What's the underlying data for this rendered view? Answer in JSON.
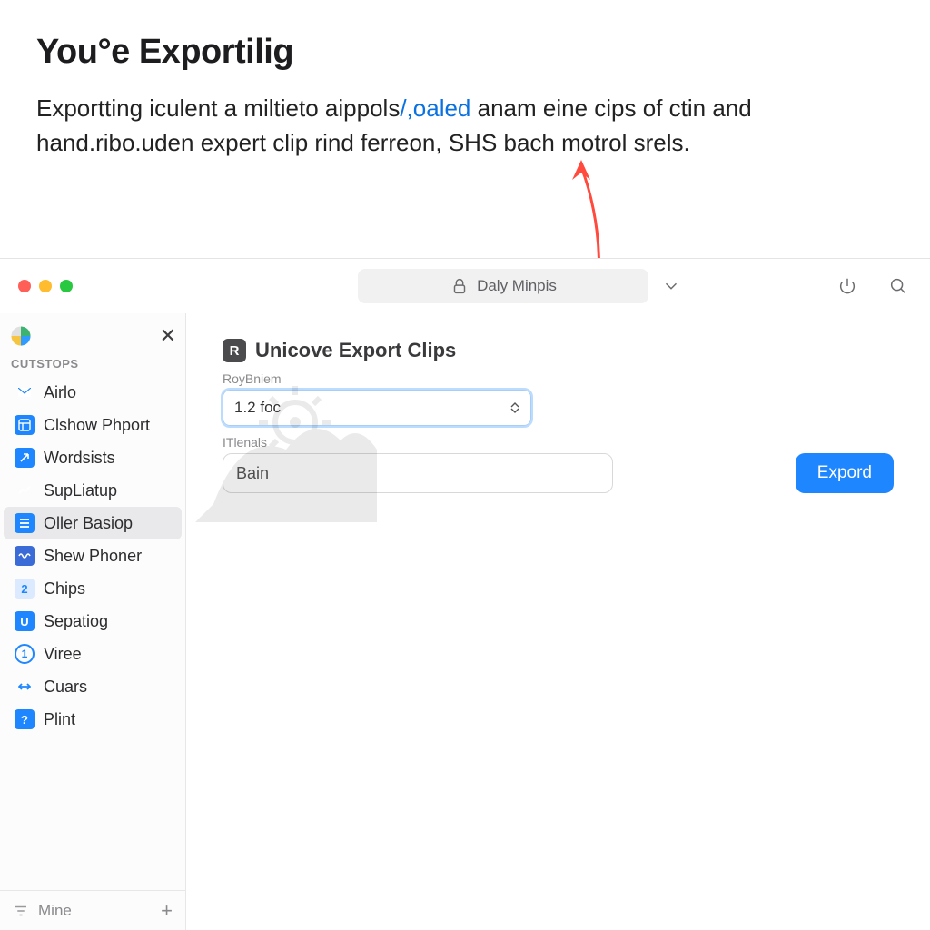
{
  "header": {
    "title": "You°e Exportilig",
    "desc_before": "Exportting iculent a miltieto aippols",
    "desc_link": "/,oaled",
    "desc_after": " anam eine cips of ctin and hand.ribo.uden expert clip rind ferreon, SHS bach motrol srels."
  },
  "toolbar": {
    "address": "Daly Minpis"
  },
  "sidebar": {
    "section_label": "CUTSTOPS",
    "items": [
      {
        "label": "Airlo",
        "icon": "envelope",
        "color": "#1e86ff"
      },
      {
        "label": "Clshow Phport",
        "icon": "grid",
        "color": "#1e86ff"
      },
      {
        "label": "Wordsists",
        "icon": "arrow",
        "color": "#1e86ff"
      },
      {
        "label": "SupLiatup",
        "icon": "chart",
        "color": "#1e86ff"
      },
      {
        "label": "Oller Basiop",
        "icon": "lines",
        "color": "#1e86ff",
        "selected": true
      },
      {
        "label": "Shew Phoner",
        "icon": "wave",
        "color": "#3a6bd6"
      },
      {
        "label": "Chips",
        "icon": "num2",
        "color": "#1e86ff"
      },
      {
        "label": "Sepatiog",
        "icon": "u",
        "color": "#1e86ff"
      },
      {
        "label": "Viree",
        "icon": "circle1",
        "color": "#ffffff"
      },
      {
        "label": "Cuars",
        "icon": "arrows",
        "color": "#1e86ff"
      },
      {
        "label": "Plint",
        "icon": "question",
        "color": "#1e86ff"
      }
    ],
    "bottom_label": "Mine"
  },
  "panel": {
    "badge_letter": "R",
    "title": "Unicove Export Clips",
    "field1_label": "RoyBniem",
    "field1_value": "1.2 foc",
    "field2_label": "ITlenals",
    "field2_value": "Bain",
    "export_button": "Expord"
  }
}
